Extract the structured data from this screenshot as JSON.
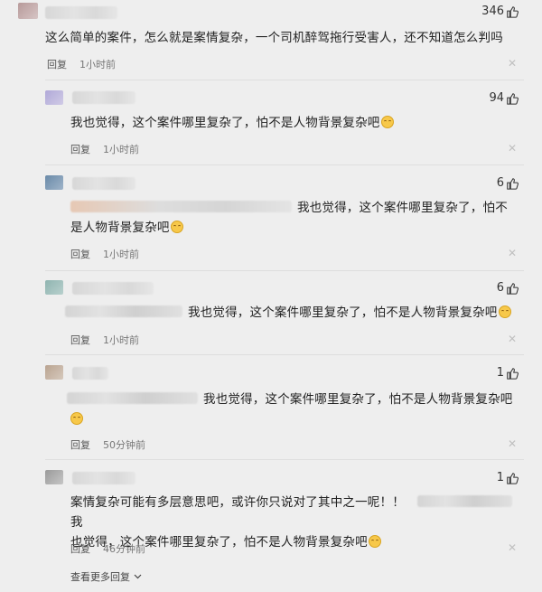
{
  "comments": [
    {
      "likes": "346",
      "text": "这么简单的案件，怎么就是案情复杂，一个司机醉驾拖行受害人，还不知道怎么判吗",
      "reply_label": "回复",
      "time": "1小时前"
    },
    {
      "likes": "94",
      "text": "我也觉得，这个案件哪里复杂了，怕不是人物背景复杂吧",
      "reply_label": "回复",
      "time": "1小时前"
    },
    {
      "likes": "6",
      "text_line1": "我也觉得，这个案件哪里复杂了，怕不",
      "text_line2": "是人物背景复杂吧",
      "reply_label": "回复",
      "time": "1小时前"
    },
    {
      "likes": "6",
      "text": "我也觉得，这个案件哪里复杂了，怕不是人物背景复杂吧",
      "reply_label": "回复",
      "time": "1小时前"
    },
    {
      "likes": "1",
      "text": "我也觉得，这个案件哪里复杂了，怕不是人物背景复杂吧",
      "reply_label": "回复",
      "time": "50分钟前"
    },
    {
      "likes": "1",
      "text_line1a": "案情复杂可能有多层意思吧，或许你只说对了其中之一呢！！",
      "text_line1b": "我",
      "text_line2": "也觉得，这个案件哪里复杂了，怕不是人物背景复杂吧",
      "reply_label": "回复",
      "time": "46分钟前"
    }
  ],
  "show_more": "查看更多回复",
  "icons": {
    "thumb": "thumbs-up-icon",
    "close": "close-icon",
    "emoji": "smile-emoji-icon"
  }
}
